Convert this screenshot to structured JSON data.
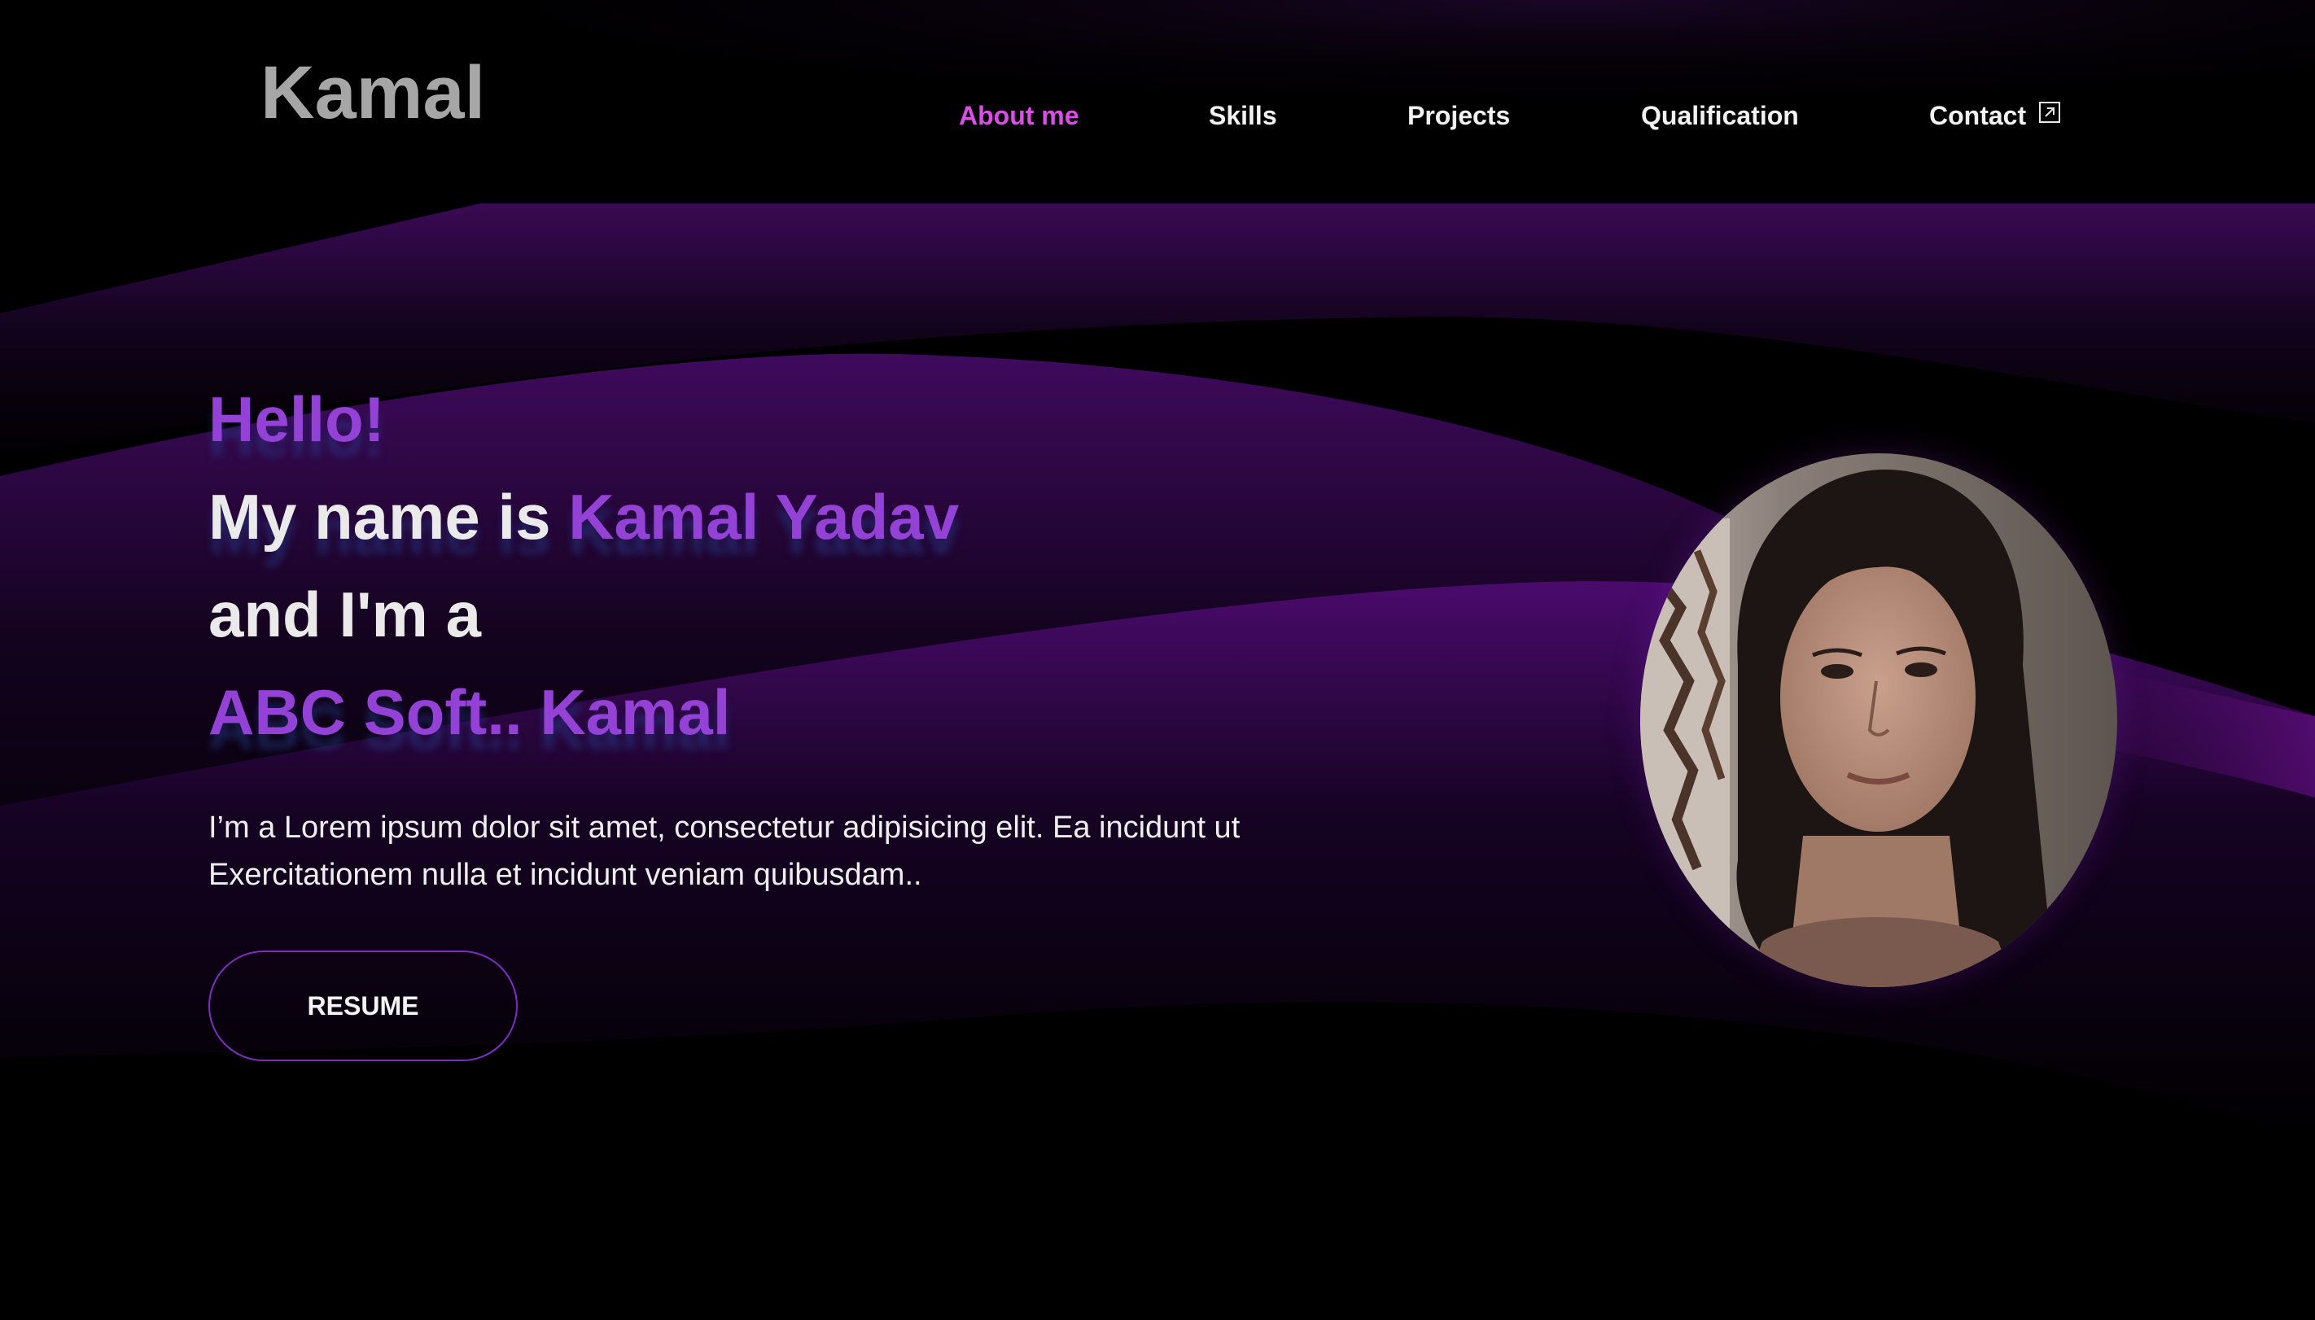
{
  "brand": {
    "logo_text": "Kamal"
  },
  "nav": {
    "items": [
      {
        "label": "About me",
        "active": true
      },
      {
        "label": "Skills",
        "active": false
      },
      {
        "label": "Projects",
        "active": false
      },
      {
        "label": "Qualification",
        "active": false
      },
      {
        "label": "Contact",
        "active": false,
        "icon": "external-link-icon"
      }
    ]
  },
  "hero": {
    "greeting": "Hello!",
    "name_prefix": "My name is ",
    "name": "Kamal Yadav",
    "role_prefix": "and I'm a",
    "role": "ABC Soft.. Kamal",
    "description": "I’m a Lorem ipsum dolor sit amet, consectetur adipisicing elit. Ea incidunt ut Exercitationem nulla et incidunt veniam quibusdam..",
    "resume_button": "RESUME"
  },
  "colors": {
    "background": "#000000",
    "accent_purple": "#9442d6",
    "nav_active": "#d94fe6",
    "logo": "#a6a6a6",
    "wave": "#5a0d80"
  },
  "profile": {
    "image": "profile-photo"
  }
}
